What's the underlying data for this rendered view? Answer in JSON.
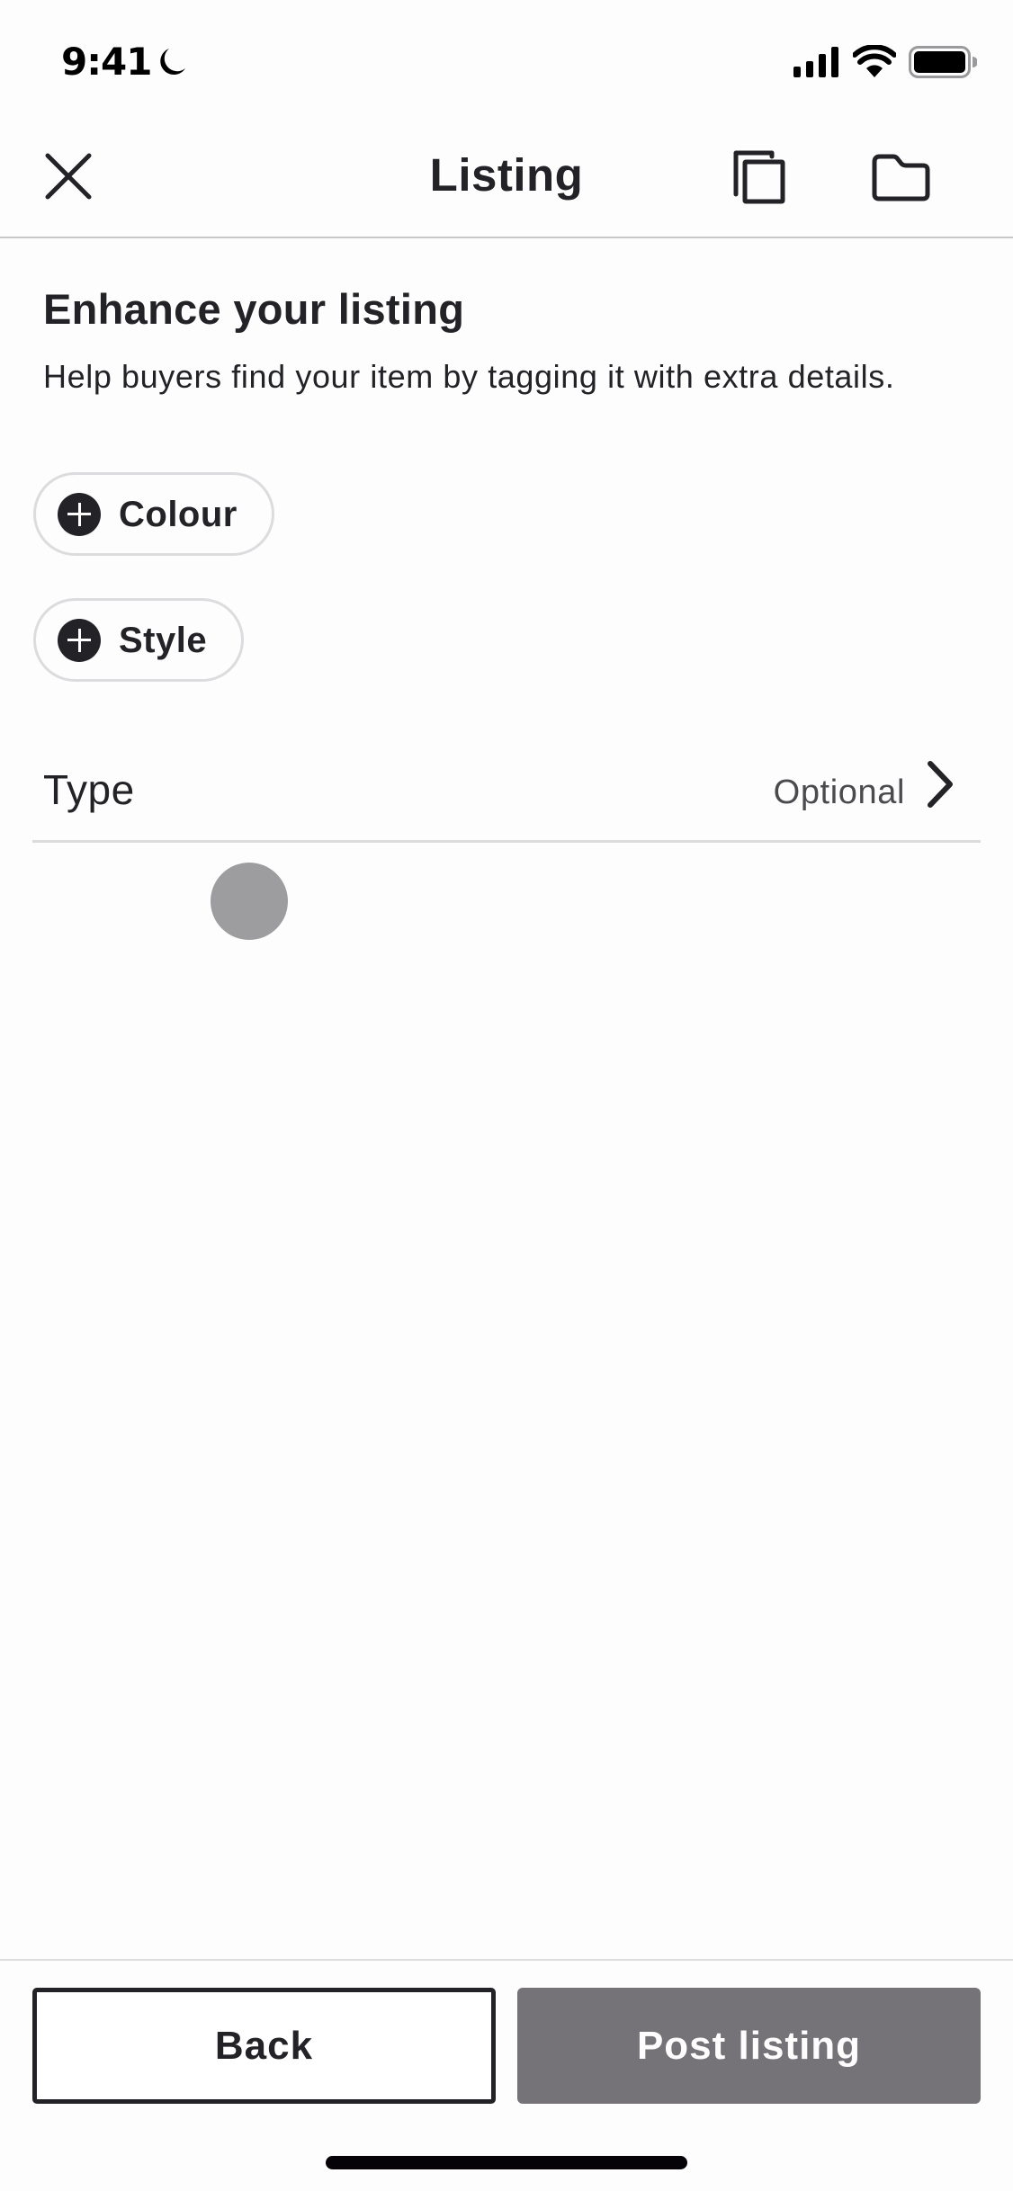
{
  "status_bar": {
    "time": "9:41",
    "focus_icon": "moon-icon",
    "signal_icon": "cellular-signal-icon",
    "wifi_icon": "wifi-icon",
    "battery_icon": "battery-icon"
  },
  "header": {
    "title": "Listing",
    "close_icon": "close-icon",
    "duplicate_icon": "duplicate-icon",
    "folder_icon": "folder-icon"
  },
  "content": {
    "heading": "Enhance your listing",
    "description": "Help buyers find your item by tagging it with extra details.",
    "chips": [
      {
        "label": "Colour",
        "icon": "plus-circle-icon"
      },
      {
        "label": "Style",
        "icon": "plus-circle-icon"
      }
    ],
    "type_row": {
      "label": "Type",
      "value": "Optional",
      "icon": "chevron-right-icon"
    }
  },
  "footer": {
    "back_label": "Back",
    "post_label": "Post listing"
  },
  "colors": {
    "text": "#232226",
    "secondary_text": "#4b4a4f",
    "border": "#dcdbde",
    "disabled_button": "#757377",
    "touch_indicator": "#9d9c9f"
  }
}
